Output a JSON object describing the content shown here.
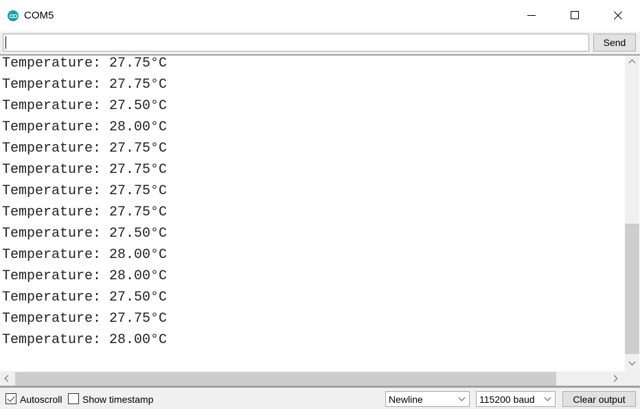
{
  "window": {
    "title": "COM5",
    "app_icon": "arduino-icon",
    "controls": {
      "minimize": "minimize-icon",
      "maximize": "maximize-icon",
      "close": "close-icon"
    }
  },
  "input_row": {
    "value": "",
    "send_label": "Send"
  },
  "output": {
    "lines": [
      "Temperature: 27.75°C",
      "Temperature: 27.75°C",
      "Temperature: 27.50°C",
      "Temperature: 28.00°C",
      "Temperature: 27.75°C",
      "Temperature: 27.75°C",
      "Temperature: 27.75°C",
      "Temperature: 27.75°C",
      "Temperature: 27.50°C",
      "Temperature: 28.00°C",
      "Temperature: 28.00°C",
      "Temperature: 27.50°C",
      "Temperature: 27.75°C",
      "Temperature: 28.00°C"
    ]
  },
  "bottom_bar": {
    "autoscroll_label": "Autoscroll",
    "autoscroll_checked": true,
    "timestamp_label": "Show timestamp",
    "timestamp_checked": false,
    "line_ending": "Newline",
    "baud_rate": "115200 baud",
    "clear_label": "Clear output"
  }
}
